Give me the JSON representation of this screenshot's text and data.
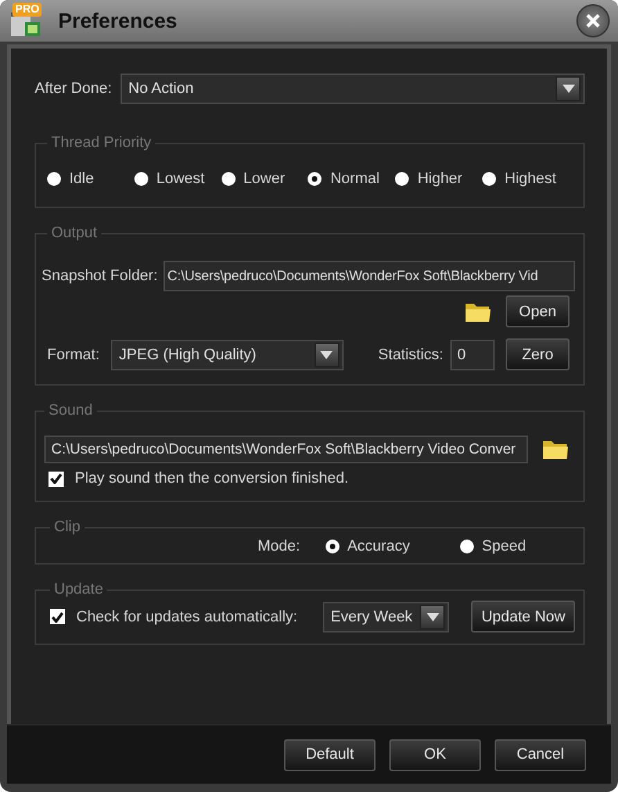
{
  "window": {
    "title": "Preferences",
    "badge": "PRO"
  },
  "after_done": {
    "label": "After Done:",
    "value": "No Action"
  },
  "thread_priority": {
    "title": "Thread Priority",
    "options": [
      {
        "label": "Idle",
        "selected": false
      },
      {
        "label": "Lowest",
        "selected": false
      },
      {
        "label": "Lower",
        "selected": false
      },
      {
        "label": "Normal",
        "selected": true
      },
      {
        "label": "Higher",
        "selected": false
      },
      {
        "label": "Highest",
        "selected": false
      }
    ]
  },
  "output": {
    "title": "Output",
    "snapshot_folder": {
      "label": "Snapshot Folder:",
      "value": "C:\\Users\\pedruco\\Documents\\WonderFox Soft\\Blackberry Vid"
    },
    "open_button": "Open",
    "format": {
      "label": "Format:",
      "value": "JPEG (High Quality)"
    },
    "statistics": {
      "label": "Statistics:",
      "value": "0"
    },
    "zero_button": "Zero"
  },
  "sound": {
    "title": "Sound",
    "path": "C:\\Users\\pedruco\\Documents\\WonderFox Soft\\Blackberry Video Conver",
    "play_sound": {
      "label": "Play sound then the conversion finished.",
      "checked": true
    }
  },
  "clip": {
    "title": "Clip",
    "mode_label": "Mode:",
    "options": [
      {
        "label": "Accuracy",
        "selected": true
      },
      {
        "label": "Speed",
        "selected": false
      }
    ]
  },
  "update": {
    "title": "Update",
    "auto_check": {
      "label": "Check for updates automatically:",
      "checked": true
    },
    "frequency": "Every Week",
    "update_button": "Update Now"
  },
  "buttons": [
    "Default",
    "OK",
    "Cancel"
  ]
}
